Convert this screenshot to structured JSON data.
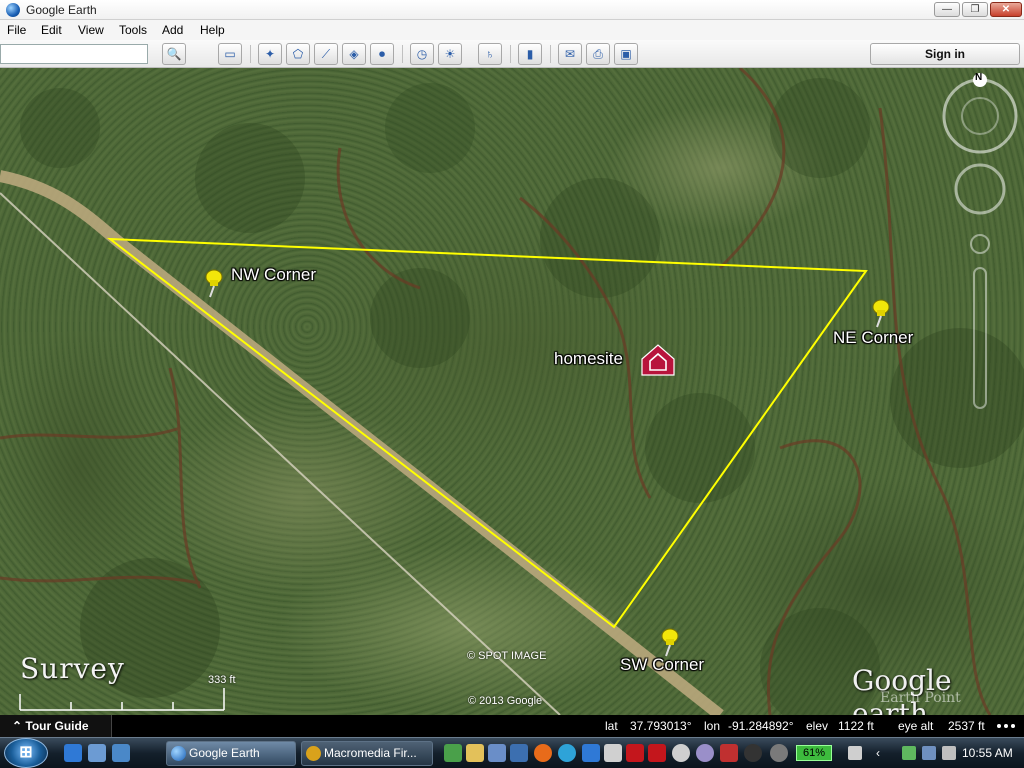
{
  "window": {
    "title": "Google Earth",
    "controls": {
      "minimize": "—",
      "maximize": "❐",
      "close": "✕"
    }
  },
  "menu": {
    "items": [
      "File",
      "Edit",
      "View",
      "Tools",
      "Add",
      "Help"
    ]
  },
  "toolbar": {
    "search_value": "",
    "buttons": [
      {
        "name": "search-button",
        "icon": "magnifier-icon",
        "glyph": "🔍"
      },
      {
        "name": "sidebar-toggle-button",
        "icon": "sidebar-icon",
        "glyph": "▭"
      },
      {
        "name": "add-placemark-button",
        "icon": "placemark-icon",
        "glyph": "✦"
      },
      {
        "name": "add-polygon-button",
        "icon": "polygon-icon",
        "glyph": "⬠"
      },
      {
        "name": "add-path-button",
        "icon": "path-icon",
        "glyph": "⟋"
      },
      {
        "name": "add-overlay-button",
        "icon": "overlay-icon",
        "glyph": "◈"
      },
      {
        "name": "record-tour-button",
        "icon": "camera-icon",
        "glyph": "⏺"
      },
      {
        "name": "historical-imagery-button",
        "icon": "clock-icon",
        "glyph": "◷"
      },
      {
        "name": "sunlight-button",
        "icon": "sun-icon",
        "glyph": "☀"
      },
      {
        "name": "switch-planet-button",
        "icon": "planet-icon",
        "glyph": "♄"
      },
      {
        "name": "ruler-button",
        "icon": "ruler-icon",
        "glyph": "▮"
      },
      {
        "name": "email-button",
        "icon": "email-icon",
        "glyph": "✉"
      },
      {
        "name": "print-button",
        "icon": "printer-icon",
        "glyph": "⎙"
      },
      {
        "name": "save-image-button",
        "icon": "image-icon",
        "glyph": "▣"
      }
    ],
    "sign_in": "Sign in"
  },
  "map": {
    "compass_letter": "N",
    "labels": {
      "nw": "NW Corner",
      "ne": "NE Corner",
      "sw": "SW Corner",
      "homesite": "homesite"
    },
    "boundary_color": "#ffff00",
    "pin_color": "#f2e60a",
    "homesite_icon_color": "#b8143c",
    "tour_title": "Survey",
    "scale_label": "333 ft",
    "credits": {
      "spot": "© SPOT IMAGE",
      "google": "© 2013 Google"
    },
    "logo": "Google earth",
    "logo_sub": "Earth Point"
  },
  "status": {
    "tour_guide": "Tour Guide",
    "lat_label": "lat",
    "lat_value": "37.793013°",
    "lon_label": "lon",
    "lon_value": "-91.284892°",
    "elev_label": "elev",
    "elev_value": "1122 ft",
    "eye_label": "eye alt",
    "eye_value": "2537 ft"
  },
  "taskbar": {
    "tasks": [
      {
        "label": "Google Earth",
        "icon": "google-earth-icon"
      },
      {
        "label": "Macromedia Fir...",
        "icon": "fireworks-icon"
      }
    ],
    "battery": "61%",
    "clock": "10:55 AM"
  }
}
